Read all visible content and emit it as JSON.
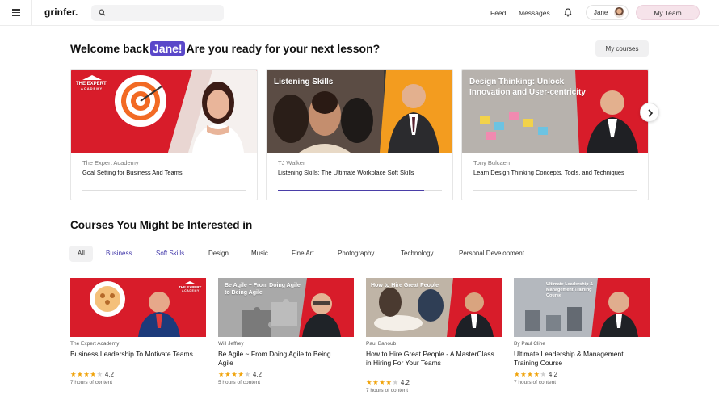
{
  "topbar": {
    "logo": "grinfer.",
    "search_placeholder": "",
    "nav": [
      "Feed",
      "Messages"
    ],
    "user_name": "Jane",
    "team_button": "My Team"
  },
  "welcome": {
    "prefix": "Welcome back",
    "name": "Jane!",
    "suffix": "Are you ready for your next lesson?",
    "my_courses": "My courses"
  },
  "current_courses": [
    {
      "thumb_text": "",
      "badge_line1": "THE EXPERT",
      "badge_line2": "ACADEMY",
      "provider": "The Expert Academy",
      "title": "Goal Setting for Business And Teams",
      "progress": 0.0
    },
    {
      "thumb_text": "Listening Skills",
      "provider": "TJ Walker",
      "title": "Listening Skills: The Ultimate Workplace Soft Skills",
      "progress": 0.89
    },
    {
      "thumb_text": "Design Thinking: Unlock Innovation and User-centricity",
      "provider": "Tony Bulcaen",
      "title": "Learn Design Thinking Concepts, Tools, and Techniques",
      "progress": 0.0
    }
  ],
  "recommended": {
    "heading": "Courses You Might be Interested in",
    "filters": [
      "All",
      "Business",
      "Soft Skills",
      "Design",
      "Music",
      "Fine Art",
      "Photography",
      "Technology",
      "Personal Development"
    ],
    "courses": [
      {
        "thumb_text": "",
        "badge_line1": "THE EXPERT",
        "badge_line2": "ACADEMY",
        "author": "The Expert Academy",
        "title": "Business Leadership To Motivate Teams",
        "rating": "4.2",
        "stars": 4,
        "duration": "7 hours of content"
      },
      {
        "thumb_text": "Be Agile ~ From Doing Agile to Being Agile",
        "author": "Will Jeffrey",
        "title": "Be Agile ~ From Doing Agile to Being Agile",
        "rating": "4.2",
        "stars": 4,
        "duration": "5 hours of content"
      },
      {
        "thumb_text": "How to Hire Great People",
        "author": "Paul Banoub",
        "title": "How to Hire Great People - A MasterClass in Hiring For Your Teams",
        "rating": "4.2",
        "stars": 4,
        "duration": "7 hours of content"
      },
      {
        "thumb_text": "Ultimate Leadership & Management Training Course",
        "author": "By Paul Cline",
        "title": "Ultimate Leadership & Management Training Course",
        "rating": "4.2",
        "stars": 4,
        "duration": "7 hours of content"
      }
    ]
  },
  "colors": {
    "accent": "#5a48c9",
    "thumb_red": "#e0202e",
    "thumb_orange": "#f29a1f",
    "star": "#f0a30a"
  }
}
